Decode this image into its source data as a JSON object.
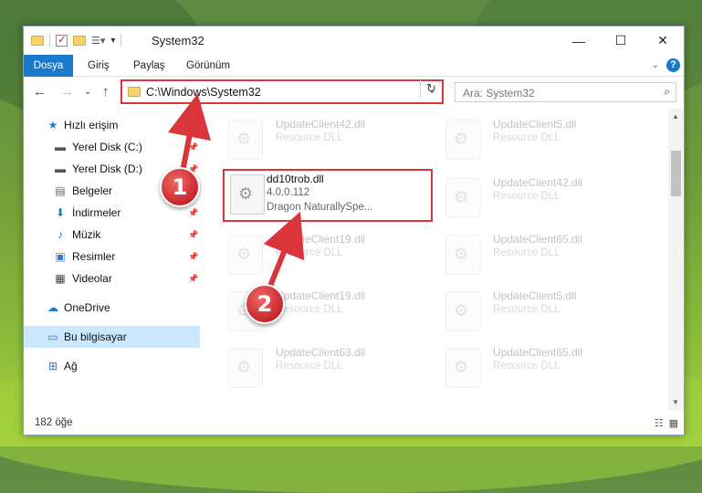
{
  "window": {
    "title": "System32"
  },
  "ribbon": {
    "tabs": [
      "Dosya",
      "Giriş",
      "Paylaş",
      "Görünüm"
    ]
  },
  "address": {
    "path": "C:\\Windows\\System32"
  },
  "search": {
    "placeholder": "Ara: System32"
  },
  "nav": {
    "items": [
      {
        "label": "Hızlı erişim",
        "icon": "star-icon"
      },
      {
        "label": "Yerel Disk (C:)",
        "icon": "drive-icon"
      },
      {
        "label": "Yerel Disk (D:)",
        "icon": "drive-icon"
      },
      {
        "label": "Belgeler",
        "icon": "document-icon"
      },
      {
        "label": "İndirmeler",
        "icon": "download-icon"
      },
      {
        "label": "Müzik",
        "icon": "music-icon"
      },
      {
        "label": "Resimler",
        "icon": "pictures-icon"
      },
      {
        "label": "Videolar",
        "icon": "video-icon"
      },
      {
        "label": "OneDrive",
        "icon": "cloud-icon"
      },
      {
        "label": "Bu bilgisayar",
        "icon": "computer-icon"
      },
      {
        "label": "Ağ",
        "icon": "network-icon"
      }
    ]
  },
  "files": [
    {
      "name": "UpdateClient42.dll",
      "desc": "Resource DLL"
    },
    {
      "name": "UpdateClient5.dll",
      "desc": "Resource DLL"
    },
    {
      "name": "UpdateClient42.dll",
      "desc": "Resource DLL"
    },
    {
      "name": "UpdateClient19.dll",
      "desc": "Resource DLL"
    },
    {
      "name": "UpdateClient65.dll",
      "desc": "Resource DLL"
    },
    {
      "name": "UpdateClient19.dll",
      "desc": "Resource DLL"
    },
    {
      "name": "UpdateClient5.dll",
      "desc": "Resource DLL"
    },
    {
      "name": "UpdateClient63.dll",
      "desc": "Resource DLL"
    },
    {
      "name": "UpdateClient65.dll",
      "desc": "Resource DLL"
    }
  ],
  "highlighted_file": {
    "name": "dd10trob.dll",
    "version": "4.0.0.112",
    "desc": "Dragon NaturallySpe..."
  },
  "status": {
    "count": "182 öğe"
  },
  "callouts": [
    "1",
    "2"
  ],
  "colors": {
    "accent": "#1979ca",
    "callout": "#d9353a",
    "selection": "#cce8ff"
  }
}
